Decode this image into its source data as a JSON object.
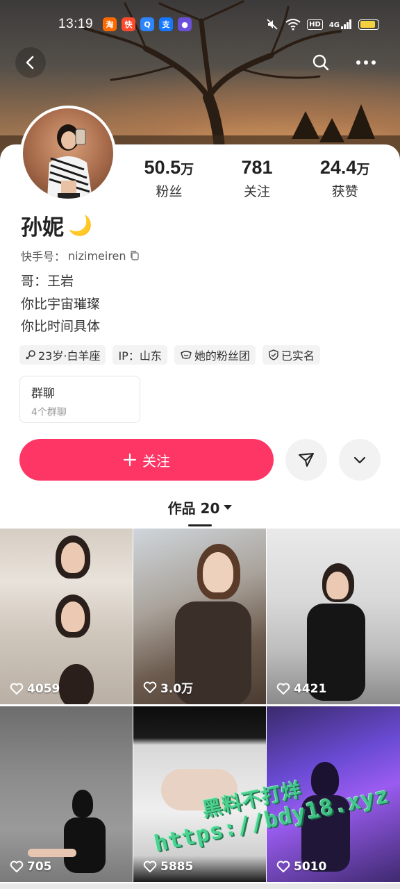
{
  "status_bar": {
    "time": "13:19",
    "hd_label": "HD",
    "network_label": "4G",
    "app_icons": [
      {
        "icon": "taobao-icon",
        "color": "#ff6a00",
        "glyph": "淘"
      },
      {
        "icon": "kuaishou-app-icon",
        "color": "#ff4b2b",
        "glyph": "快"
      },
      {
        "icon": "search-app-icon",
        "color": "#2e86ff",
        "glyph": "Q"
      },
      {
        "icon": "alipay-icon",
        "color": "#1677ff",
        "glyph": "支"
      },
      {
        "icon": "purple-app-icon",
        "color": "#6b4fd8",
        "glyph": "●"
      }
    ],
    "battery_color": "#f4d03f"
  },
  "profile": {
    "name": "孙妮",
    "name_emoji": "🌙",
    "id_label": "快手号：",
    "id_value": "nizimeiren",
    "bio": [
      "哥：王岩",
      "你比宇宙璀璨",
      "你比时间具体"
    ],
    "stats": [
      {
        "num": "50.5",
        "unit": "万",
        "label": "粉丝"
      },
      {
        "num": "781",
        "unit": "",
        "label": "关注"
      },
      {
        "num": "24.4",
        "unit": "万",
        "label": "获赞"
      }
    ],
    "tags": [
      {
        "icon": "gender-female-icon",
        "text": "23岁·白羊座"
      },
      {
        "icon": "",
        "text": "IP：山东"
      },
      {
        "icon": "fan-club-icon",
        "text": "她的粉丝团"
      },
      {
        "icon": "verified-shield-icon",
        "text": "已实名"
      }
    ]
  },
  "group_chat": {
    "title": "群聊",
    "subtitle": "4个群聊"
  },
  "actions": {
    "follow_label": "关注",
    "accent": "#fe3666"
  },
  "works_tab": {
    "label": "作品 20"
  },
  "grid": [
    {
      "likes": "4059"
    },
    {
      "likes": "3.0万"
    },
    {
      "likes": "4421"
    },
    {
      "likes": "705"
    },
    {
      "likes": "5885"
    },
    {
      "likes": "5010"
    }
  ],
  "watermark": {
    "line1": "黑料不打烊",
    "line2": "https://bdy18.xyz",
    "color": "#3fd08a"
  }
}
